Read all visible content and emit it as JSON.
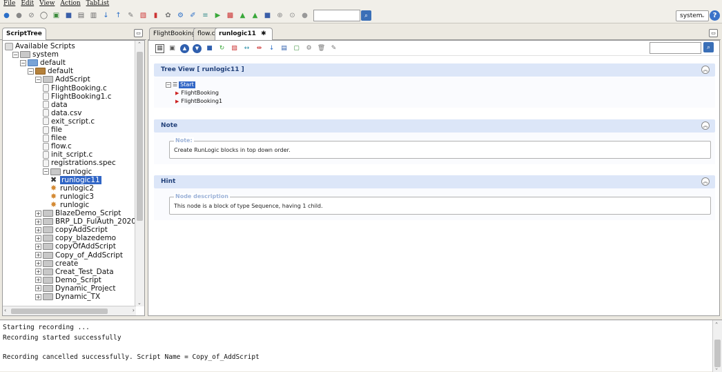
{
  "menu": [
    "File",
    "Edit",
    "View",
    "Action",
    "TabList"
  ],
  "toolbar": {
    "icons": [
      {
        "name": "record-icon",
        "glyph": "●",
        "color": "#2b6fc8"
      },
      {
        "name": "stop-icon",
        "glyph": "●",
        "color": "#888"
      },
      {
        "name": "cancel-icon",
        "glyph": "⊘",
        "color": "#777"
      },
      {
        "name": "comment-icon",
        "glyph": "◯",
        "color": "#555"
      },
      {
        "name": "import-icon",
        "glyph": "▣",
        "color": "#3c8b3c"
      },
      {
        "name": "save-icon",
        "glyph": "■",
        "color": "#3a5ea8"
      },
      {
        "name": "print-icon",
        "glyph": "▤",
        "color": "#666"
      },
      {
        "name": "copy-icon",
        "glyph": "▥",
        "color": "#666"
      },
      {
        "name": "download-icon",
        "glyph": "↓",
        "color": "#2b6fc8"
      },
      {
        "name": "upload-icon",
        "glyph": "↑",
        "color": "#2b6fc8"
      },
      {
        "name": "tools-icon",
        "glyph": "✎",
        "color": "#777"
      },
      {
        "name": "script-icon",
        "glyph": "▧",
        "color": "#c33"
      },
      {
        "name": "delete-icon",
        "glyph": "▮",
        "color": "#c33"
      },
      {
        "name": "tag-icon",
        "glyph": "✿",
        "color": "#777"
      },
      {
        "name": "settings-icon",
        "glyph": "⚙",
        "color": "#2b6fc8"
      },
      {
        "name": "edit-icon",
        "glyph": "✐",
        "color": "#2b6fc8"
      },
      {
        "name": "link-icon",
        "glyph": "≡",
        "color": "#3a8f8f"
      },
      {
        "name": "play-icon",
        "glyph": "▶",
        "color": "#3aa83a"
      },
      {
        "name": "report-icon",
        "glyph": "▩",
        "color": "#c33"
      },
      {
        "name": "export-icon",
        "glyph": "▲",
        "color": "#3aa83a"
      },
      {
        "name": "upload-green-icon",
        "glyph": "▲",
        "color": "#3aa83a"
      },
      {
        "name": "floppy-icon",
        "glyph": "■",
        "color": "#3a5ea8"
      },
      {
        "name": "forward-icon",
        "glyph": "⊕",
        "color": "#888"
      },
      {
        "name": "next-icon",
        "glyph": "⊙",
        "color": "#888"
      },
      {
        "name": "gray-circle-icon",
        "glyph": "●",
        "color": "#999"
      }
    ],
    "search_placeholder": "",
    "user": "system"
  },
  "left_panel": {
    "tab_label": "ScriptTree",
    "tree": [
      {
        "label": "Available Scripts",
        "level": 0,
        "kind": "root"
      },
      {
        "label": "system",
        "level": 1,
        "kind": "folder-gray",
        "exp": "−"
      },
      {
        "label": "default",
        "level": 2,
        "kind": "folder-blue",
        "exp": "−"
      },
      {
        "label": "default",
        "level": 3,
        "kind": "folder-brown",
        "exp": "−"
      },
      {
        "label": "AddScript",
        "level": 4,
        "kind": "folder-gray",
        "exp": "−"
      },
      {
        "label": "FlightBooking.c",
        "level": 5,
        "kind": "file"
      },
      {
        "label": "FlightBooking1.c",
        "level": 5,
        "kind": "file"
      },
      {
        "label": "data",
        "level": 5,
        "kind": "file"
      },
      {
        "label": "data.csv",
        "level": 5,
        "kind": "file"
      },
      {
        "label": "exit_script.c",
        "level": 5,
        "kind": "file"
      },
      {
        "label": "file",
        "level": 5,
        "kind": "file"
      },
      {
        "label": "filee",
        "level": 5,
        "kind": "file"
      },
      {
        "label": "flow.c",
        "level": 5,
        "kind": "file"
      },
      {
        "label": "init_script.c",
        "level": 5,
        "kind": "file"
      },
      {
        "label": "registrations.spec",
        "level": 5,
        "kind": "file"
      },
      {
        "label": "runlogic",
        "level": 5,
        "kind": "folder-gray",
        "exp": "−"
      },
      {
        "label": "runlogic11",
        "level": 6,
        "kind": "runlogic-selected"
      },
      {
        "label": "runlogic2",
        "level": 6,
        "kind": "gear"
      },
      {
        "label": "runlogic3",
        "level": 6,
        "kind": "gear"
      },
      {
        "label": "runlogic",
        "level": 6,
        "kind": "gear"
      },
      {
        "label": "BlazeDemo_Script",
        "level": 4,
        "kind": "folder-gray",
        "exp": "+"
      },
      {
        "label": "BRP_LD_FulAuth_2020",
        "level": 4,
        "kind": "folder-gray",
        "exp": "+"
      },
      {
        "label": "copyAddScript",
        "level": 4,
        "kind": "folder-gray",
        "exp": "+"
      },
      {
        "label": "copy_blazedemo",
        "level": 4,
        "kind": "folder-gray",
        "exp": "+"
      },
      {
        "label": "copyOfAddScript",
        "level": 4,
        "kind": "folder-gray",
        "exp": "+"
      },
      {
        "label": "Copy_of_AddScript",
        "level": 4,
        "kind": "folder-gray",
        "exp": "+"
      },
      {
        "label": "create",
        "level": 4,
        "kind": "folder-gray",
        "exp": "+"
      },
      {
        "label": "Creat_Test_Data",
        "level": 4,
        "kind": "folder-gray",
        "exp": "+"
      },
      {
        "label": "Demo_Script",
        "level": 4,
        "kind": "folder-gray",
        "exp": "+"
      },
      {
        "label": "Dynamic_Project",
        "level": 4,
        "kind": "folder-gray",
        "exp": "+"
      },
      {
        "label": "Dynamic_TX",
        "level": 4,
        "kind": "folder-gray",
        "exp": "+"
      }
    ]
  },
  "editor": {
    "tabs": [
      {
        "label": "FlightBooking.c"
      },
      {
        "label": "flow.c"
      },
      {
        "label": "runlogic11",
        "active": true
      }
    ],
    "active_tab_suffix": "✱ ✕",
    "tree_view": {
      "title": "Tree View [ runlogic11 ]",
      "root": "Start",
      "children": [
        "FlightBooking",
        "FlightBooking1"
      ]
    },
    "note": {
      "title": "Note",
      "legend": "Note:",
      "text": "Create RunLogic blocks in top down order."
    },
    "hint": {
      "title": "Hint",
      "legend": "Node description",
      "text": "This node is a block of type Sequence, having 1 child."
    }
  },
  "console": {
    "lines": [
      "Starting recording ...",
      "Recording started successfully",
      "",
      "Recording cancelled successfully. Script Name = Copy_of_AddScript"
    ]
  }
}
